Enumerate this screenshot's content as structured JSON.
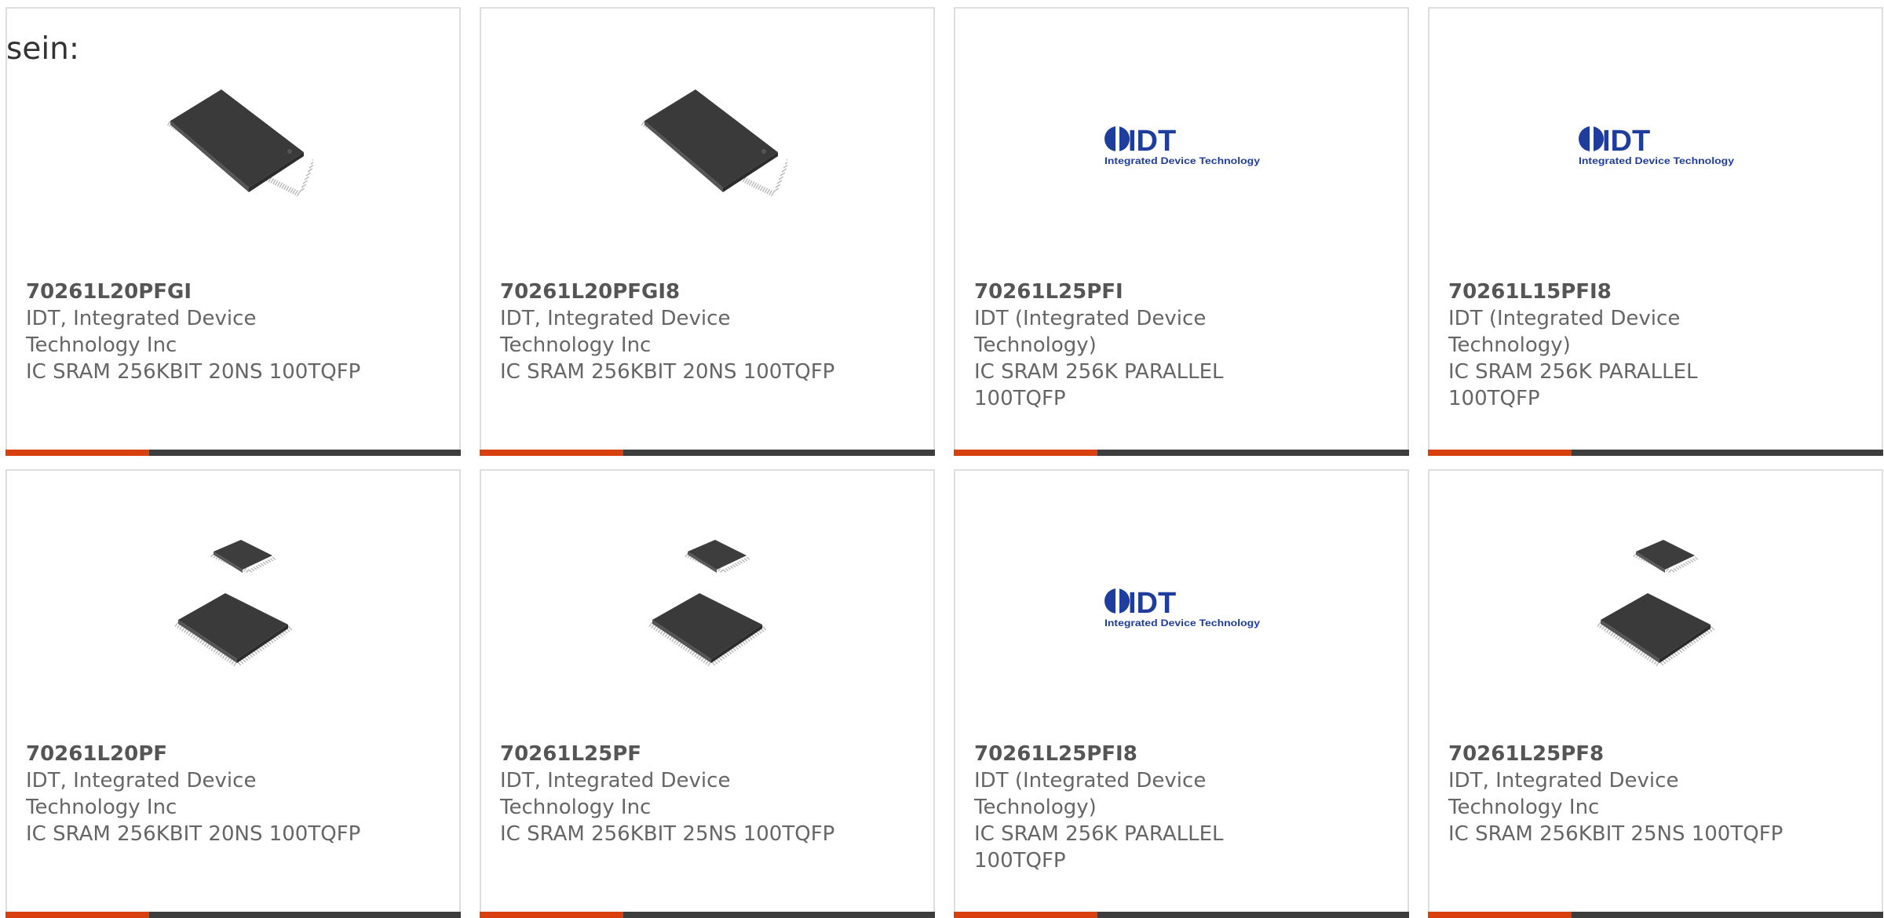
{
  "intro_text": "sein:",
  "colors": {
    "accent": "#d9400f",
    "bar": "#3d3d3d",
    "border": "#dedede",
    "idt_blue": "#1f3d9c"
  },
  "logo_lines": {
    "brand": "IDT",
    "tagline": "Integrated Device Technology"
  },
  "products": [
    {
      "part": "70261L20PFGI",
      "manufacturer": "IDT, Integrated Device Technology Inc",
      "description": "IC SRAM 256KBIT 20NS 100TQFP",
      "image": "chip-large-icon"
    },
    {
      "part": "70261L20PFGI8",
      "manufacturer": "IDT, Integrated Device Technology Inc",
      "description": "IC SRAM 256KBIT 20NS 100TQFP",
      "image": "chip-large-icon"
    },
    {
      "part": "70261L25PFI",
      "manufacturer": "IDT (Integrated Device Technology)",
      "description": "IC SRAM 256K PARALLEL 100TQFP",
      "image": "idt-logo"
    },
    {
      "part": "70261L15PFI8",
      "manufacturer": "IDT (Integrated Device Technology)",
      "description": "IC SRAM 256K PARALLEL 100TQFP",
      "image": "idt-logo"
    },
    {
      "part": "70261L20PF",
      "manufacturer": "IDT, Integrated Device Technology Inc",
      "description": "IC SRAM 256KBIT 20NS 100TQFP",
      "image": "chip-pair-icon"
    },
    {
      "part": "70261L25PF",
      "manufacturer": "IDT, Integrated Device Technology Inc",
      "description": "IC SRAM 256KBIT 25NS 100TQFP",
      "image": "chip-pair-icon"
    },
    {
      "part": "70261L25PFI8",
      "manufacturer": "IDT (Integrated Device Technology)",
      "description": "IC SRAM 256K PARALLEL 100TQFP",
      "image": "idt-logo"
    },
    {
      "part": "70261L25PF8",
      "manufacturer": "IDT, Integrated Device Technology Inc",
      "description": "IC SRAM 256KBIT 25NS 100TQFP",
      "image": "chip-pair-icon"
    }
  ]
}
